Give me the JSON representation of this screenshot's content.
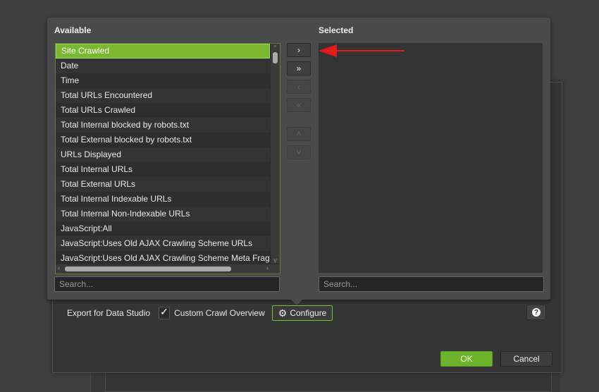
{
  "background_dialog": {
    "export_label": "Export for Data Studio",
    "custom_crawl_overview_label": "Custom Crawl Overview",
    "custom_crawl_overview_checked": true,
    "configure_label": "Configure",
    "help_icon": "question-circle-icon",
    "ok_label": "OK",
    "cancel_label": "Cancel"
  },
  "popup": {
    "available_heading": "Available",
    "selected_heading": "Selected",
    "available_items": [
      {
        "label": "Site Crawled",
        "selected": true
      },
      {
        "label": "Date"
      },
      {
        "label": "Time"
      },
      {
        "label": "Total URLs Encountered"
      },
      {
        "label": "Total URLs Crawled"
      },
      {
        "label": "Total Internal blocked by robots.txt"
      },
      {
        "label": "Total External blocked by robots.txt"
      },
      {
        "label": "URLs Displayed"
      },
      {
        "label": "Total Internal URLs"
      },
      {
        "label": "Total External URLs"
      },
      {
        "label": "Total Internal Indexable URLs"
      },
      {
        "label": "Total Internal Non-Indexable URLs"
      },
      {
        "label": "JavaScript:All"
      },
      {
        "label": "JavaScript:Uses Old AJAX Crawling Scheme URLs"
      },
      {
        "label": "JavaScript:Uses Old AJAX Crawling Scheme Meta Fragment Tag"
      }
    ],
    "selected_items": [],
    "available_search_placeholder": "Search...",
    "selected_search_placeholder": "Search...",
    "buttons": {
      "add": "›",
      "add_all": "»",
      "remove": "‹",
      "remove_all": "«",
      "move_up": "˄",
      "move_down": "˅"
    }
  },
  "annotation": {
    "type": "arrow",
    "color": "#e31b1b",
    "points_to": "add-button"
  },
  "colors": {
    "accent": "#7ab832",
    "panel": "#4a4a4a",
    "list_bg": "#2c2c2c"
  }
}
